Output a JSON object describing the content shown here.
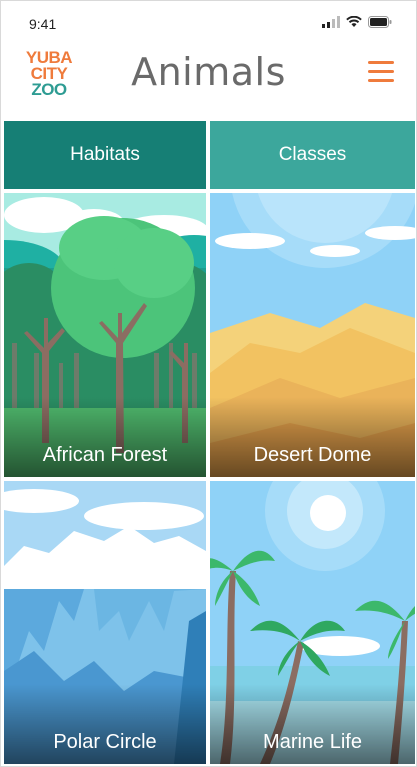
{
  "status_bar": {
    "time": "9:41"
  },
  "header": {
    "logo": {
      "line1": "YUBA",
      "line2": "CITY",
      "line3": "ZOO"
    },
    "title": "Animals"
  },
  "tabs": [
    {
      "label": "Habitats",
      "selected": true
    },
    {
      "label": "Classes",
      "selected": false
    }
  ],
  "habitats": [
    {
      "label": "African Forest"
    },
    {
      "label": "Desert Dome"
    },
    {
      "label": "Polar Circle"
    },
    {
      "label": "Marine Life"
    }
  ],
  "colors": {
    "brand_orange": "#ef7b3c",
    "brand_teal": "#2e9c93",
    "tab_selected": "#167f75",
    "tab_unselected": "#3ca79c"
  }
}
